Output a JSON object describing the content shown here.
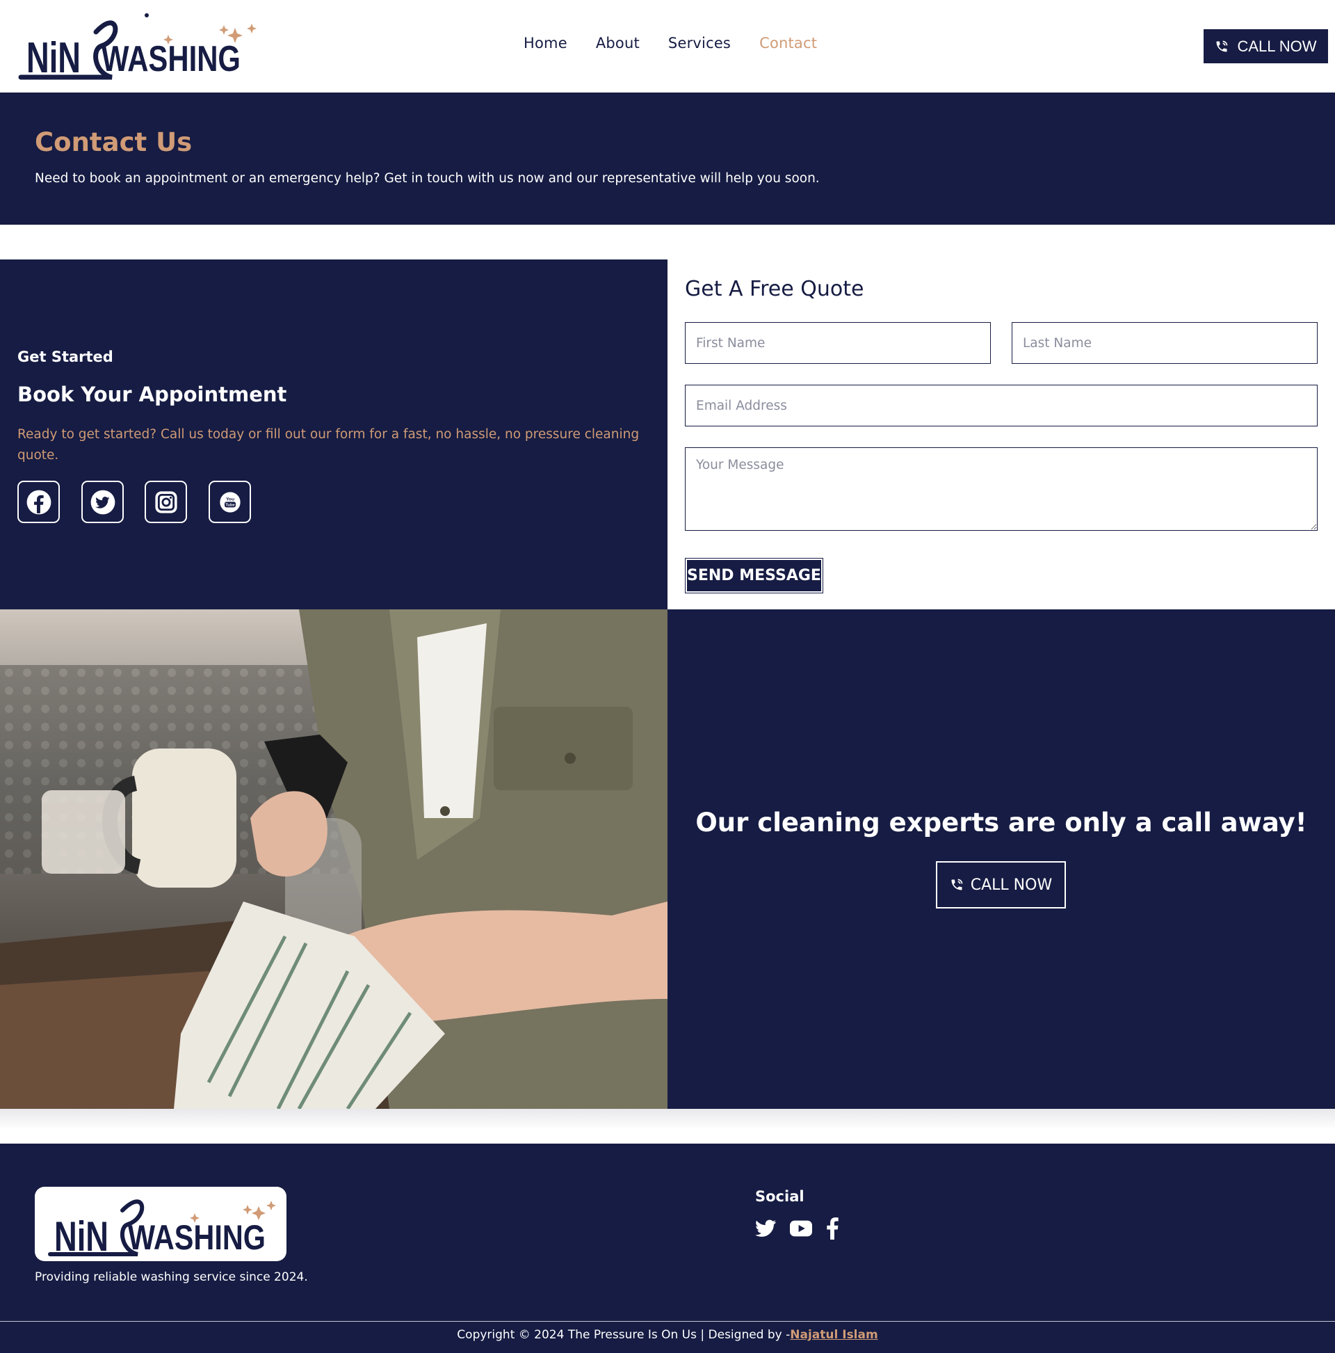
{
  "brand": {
    "logo_part1": "NiN",
    "logo_part2": "WASHING",
    "colors": {
      "navy": "#161c43",
      "accent": "#d09b76",
      "white": "#ffffff"
    }
  },
  "nav": {
    "items": [
      {
        "label": "Home"
      },
      {
        "label": "About"
      },
      {
        "label": "Services"
      },
      {
        "label": "Contact",
        "active": true
      }
    ]
  },
  "header": {
    "call_label": "CALL NOW",
    "call_icon": "phone-icon"
  },
  "hero": {
    "title": "Contact Us",
    "text": "Need to book an appointment or an emergency help? Get in touch with us now and our representative will help you soon."
  },
  "booking": {
    "kicker": "Get Started",
    "title": "Book Your Appointment",
    "text": "Ready to get started? Call us today or fill out our form for a fast, no hassle, no pressure cleaning quote.",
    "social_icons": [
      "facebook-icon",
      "twitter-icon",
      "instagram-icon",
      "youtube-icon"
    ]
  },
  "quote_form": {
    "title": "Get A Free Quote",
    "first_name_placeholder": "First Name",
    "last_name_placeholder": "Last Name",
    "email_placeholder": "Email Address",
    "message_placeholder": "Your Message",
    "submit_label": "SEND MESSAGE"
  },
  "cta": {
    "title": "Our cleaning experts are only a call away!",
    "call_label": "CALL NOW"
  },
  "footer": {
    "tagline": "Providing reliable washing service since 2024.",
    "social_title": "Social",
    "social_icons": [
      "twitter-icon",
      "youtube-icon",
      "facebook-icon"
    ],
    "copyright_prefix": "Copyright © 2024 The Pressure Is On Us | Designed by -",
    "designer": "Najatul Islam"
  }
}
